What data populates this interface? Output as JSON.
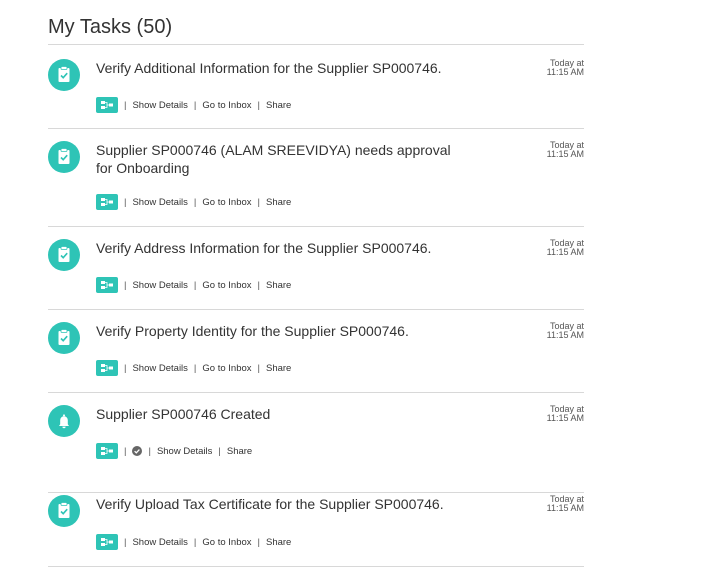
{
  "header": {
    "title": "My Tasks (50)"
  },
  "icons": {
    "task": "clipboard-check-icon",
    "notification": "bell-icon",
    "workflow": "workflow-icon",
    "status": "check-circle-icon"
  },
  "colors": {
    "accent": "#2ec4b6",
    "divider": "#d8d8d8"
  },
  "tasks": [
    {
      "title": "Verify Additional Information for the Supplier SP000746.",
      "time_line1": "Today at",
      "time_line2": "11:15 AM",
      "actions": [
        "Show Details",
        "Go to Inbox",
        "Share"
      ]
    },
    {
      "title": "Supplier SP000746 (ALAM SREEVIDYA) needs approval for Onboarding",
      "time_line1": "Today at",
      "time_line2": "11:15 AM",
      "actions": [
        "Show Details",
        "Go to Inbox",
        "Share"
      ]
    },
    {
      "title": "Verify Address Information for the Supplier SP000746.",
      "time_line1": "Today at",
      "time_line2": "11:15 AM",
      "actions": [
        "Show Details",
        "Go to Inbox",
        "Share"
      ]
    },
    {
      "title": "Verify Property Identity for the Supplier SP000746.",
      "time_line1": "Today at",
      "time_line2": "11:15 AM",
      "actions": [
        "Show Details",
        "Go to Inbox",
        "Share"
      ]
    },
    {
      "title": "Supplier SP000746 Created",
      "time_line1": "Today at",
      "time_line2": "11:15 AM",
      "actions": [
        "Show Details",
        "Share"
      ]
    },
    {
      "title": "Verify Upload Tax Certificate for the Supplier SP000746.",
      "time_line1": "Today at",
      "time_line2": "11:15 AM",
      "actions": [
        "Show Details",
        "Go to Inbox",
        "Share"
      ]
    }
  ]
}
